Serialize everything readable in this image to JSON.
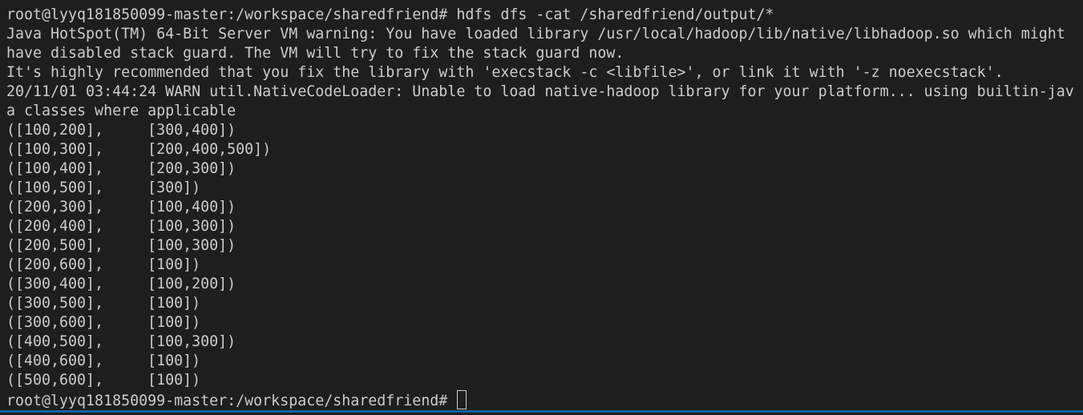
{
  "terminal": {
    "lines": [
      "root@lyyq181850099-master:/workspace/sharedfriend# hdfs dfs -cat /sharedfriend/output/*",
      "Java HotSpot(TM) 64-Bit Server VM warning: You have loaded library /usr/local/hadoop/lib/native/libhadoop.so which might",
      "have disabled stack guard. The VM will try to fix the stack guard now.",
      "It's highly recommended that you fix the library with 'execstack -c <libfile>', or link it with '-z noexecstack'.",
      "20/11/01 03:44:24 WARN util.NativeCodeLoader: Unable to load native-hadoop library for your platform... using builtin-jav",
      "a classes where applicable",
      "([100,200],     [300,400])",
      "([100,300],     [200,400,500])",
      "([100,400],     [200,300])",
      "([100,500],     [300])",
      "([200,300],     [100,400])",
      "([200,400],     [100,300])",
      "([200,500],     [100,300])",
      "([200,600],     [100])",
      "([300,400],     [100,200])",
      "([300,500],     [100])",
      "([300,600],     [100])",
      "([400,500],     [100,300])",
      "([400,600],     [100])",
      "([500,600],     [100])"
    ],
    "prompt": "root@lyyq181850099-master:/workspace/sharedfriend# "
  },
  "colors": {
    "background": "#1e1e1e",
    "foreground": "#cccccc",
    "accent_bar": "#0e639c"
  }
}
